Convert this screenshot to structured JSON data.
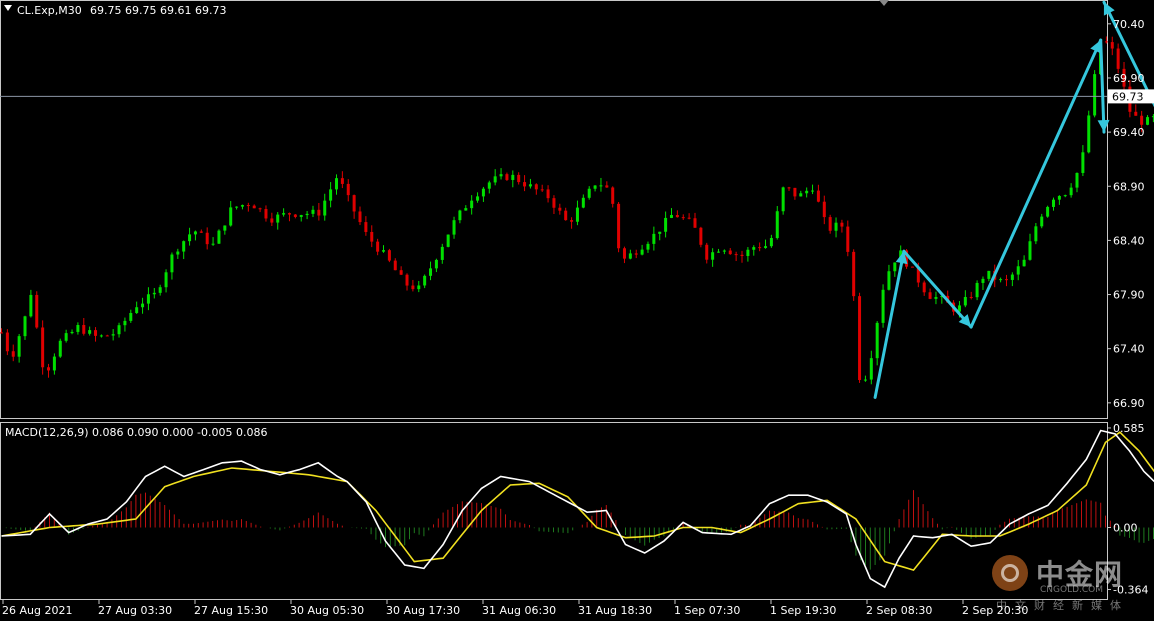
{
  "header": {
    "triangle_icon": "dropdown-triangle-icon"
  },
  "chart_data": [
    {
      "type": "candlestick",
      "title": "CL.Exp,M30",
      "ohlc_label": "69.75 69.75 69.61 69.73",
      "current_price": 69.73,
      "current_price_label": "69.73",
      "ylim": [
        66.76,
        70.62
      ],
      "y_ticks": [
        "70.40",
        "69.90",
        "69.40",
        "68.90",
        "68.40",
        "67.90",
        "67.40",
        "66.90"
      ],
      "x_labels": [
        "26 Aug 2021",
        "27 Aug 03:30",
        "27 Aug 15:30",
        "30 Aug 05:30",
        "30 Aug 17:30",
        "31 Aug 06:30",
        "31 Aug 18:30",
        "1 Sep 07:30",
        "1 Sep 19:30",
        "2 Sep 08:30",
        "2 Sep 20:30"
      ],
      "candle_count": 206,
      "up_color": "#00e000",
      "down_color": "#e00000",
      "price_path": [
        [
          0,
          67.55
        ],
        [
          2,
          67.3
        ],
        [
          5,
          67.7
        ],
        [
          6,
          67.95
        ],
        [
          9,
          67.15
        ],
        [
          12,
          67.45
        ],
        [
          16,
          67.6
        ],
        [
          20,
          67.5
        ],
        [
          24,
          67.55
        ],
        [
          28,
          67.8
        ],
        [
          32,
          67.9
        ],
        [
          36,
          68.3
        ],
        [
          40,
          68.5
        ],
        [
          44,
          68.35
        ],
        [
          48,
          68.7
        ],
        [
          52,
          68.75
        ],
        [
          56,
          68.6
        ],
        [
          60,
          68.65
        ],
        [
          66,
          68.65
        ],
        [
          70,
          69.0
        ],
        [
          72,
          68.8
        ],
        [
          76,
          68.45
        ],
        [
          80,
          68.25
        ],
        [
          84,
          68.0
        ],
        [
          87,
          67.95
        ],
        [
          90,
          68.2
        ],
        [
          94,
          68.55
        ],
        [
          98,
          68.8
        ],
        [
          102,
          68.95
        ],
        [
          106,
          69.0
        ],
        [
          110,
          68.9
        ],
        [
          114,
          68.8
        ],
        [
          118,
          68.55
        ],
        [
          121,
          68.75
        ],
        [
          124,
          68.95
        ],
        [
          127,
          68.85
        ],
        [
          129,
          68.2
        ],
        [
          132,
          68.3
        ],
        [
          136,
          68.45
        ],
        [
          140,
          68.65
        ],
        [
          144,
          68.55
        ],
        [
          147,
          68.25
        ],
        [
          150,
          68.35
        ],
        [
          154,
          68.25
        ],
        [
          157,
          68.35
        ],
        [
          160,
          68.35
        ],
        [
          163,
          68.9
        ],
        [
          166,
          68.8
        ],
        [
          169,
          68.9
        ],
        [
          172,
          68.5
        ],
        [
          175,
          68.55
        ],
        [
          177,
          68.2
        ],
        [
          179,
          67.0
        ],
        [
          181,
          67.3
        ],
        [
          184,
          68.05
        ],
        [
          187,
          68.3
        ],
        [
          190,
          68.1
        ],
        [
          193,
          67.9
        ],
        [
          196,
          67.85
        ],
        [
          199,
          67.75
        ],
        [
          202,
          67.9
        ],
        [
          205,
          68.1
        ],
        [
          209,
          68.0
        ],
        [
          213,
          68.2
        ],
        [
          216,
          68.6
        ],
        [
          219,
          68.8
        ],
        [
          222,
          68.85
        ],
        [
          225,
          69.1
        ],
        [
          227,
          69.7
        ],
        [
          229,
          70.25
        ],
        [
          231,
          70.2
        ],
        [
          233,
          69.95
        ],
        [
          235,
          69.6
        ],
        [
          237,
          69.5
        ],
        [
          239,
          69.5
        ],
        [
          241,
          69.55
        ],
        [
          243,
          69.55
        ],
        [
          245,
          69.75
        ],
        [
          247,
          69.7
        ],
        [
          249,
          69.65
        ],
        [
          251,
          69.73
        ]
      ],
      "trend_arrows": [
        [
          {
            "i": 182,
            "p": 66.95
          },
          {
            "i": 188,
            "p": 68.3
          }
        ],
        [
          {
            "i": 188,
            "p": 68.3
          },
          {
            "i": 202,
            "p": 67.6
          }
        ],
        [
          {
            "i": 202,
            "p": 67.6
          },
          {
            "i": 229,
            "p": 70.25
          }
        ],
        [
          {
            "i": 229,
            "p": 70.25
          },
          {
            "i": 243,
            "p": 69.4
          }
        ],
        [
          {
            "i": 243,
            "p": 69.4
          },
          {
            "i": 263,
            "p": 70.6
          }
        ]
      ],
      "trend_color": "#35c7dd"
    },
    {
      "type": "macd",
      "title": "MACD(12,26,9) 0.086 0.090 0.000 -0.005 0.086",
      "ylim": [
        -0.42,
        0.62
      ],
      "y_ticks": [
        "0.585",
        "0.00",
        "-0.364"
      ],
      "macd_color": "#ffffff",
      "signal_color": "#f0e020",
      "hist_up_color": "#c01010",
      "hist_down_color": "#1e7a1e",
      "macd_line": [
        [
          0,
          -0.05
        ],
        [
          6,
          -0.04
        ],
        [
          10,
          0.08
        ],
        [
          14,
          -0.03
        ],
        [
          18,
          0.02
        ],
        [
          22,
          0.05
        ],
        [
          26,
          0.15
        ],
        [
          30,
          0.3
        ],
        [
          34,
          0.36
        ],
        [
          38,
          0.3
        ],
        [
          42,
          0.34
        ],
        [
          46,
          0.38
        ],
        [
          50,
          0.39
        ],
        [
          54,
          0.34
        ],
        [
          58,
          0.31
        ],
        [
          62,
          0.34
        ],
        [
          66,
          0.38
        ],
        [
          70,
          0.3
        ],
        [
          72,
          0.27
        ],
        [
          76,
          0.15
        ],
        [
          80,
          -0.08
        ],
        [
          84,
          -0.22
        ],
        [
          88,
          -0.24
        ],
        [
          92,
          -0.1
        ],
        [
          96,
          0.1
        ],
        [
          100,
          0.23
        ],
        [
          104,
          0.3
        ],
        [
          110,
          0.27
        ],
        [
          116,
          0.18
        ],
        [
          122,
          0.09
        ],
        [
          126,
          0.1
        ],
        [
          130,
          -0.1
        ],
        [
          134,
          -0.15
        ],
        [
          138,
          -0.08
        ],
        [
          142,
          0.03
        ],
        [
          146,
          -0.03
        ],
        [
          152,
          -0.04
        ],
        [
          156,
          0.01
        ],
        [
          160,
          0.14
        ],
        [
          164,
          0.19
        ],
        [
          168,
          0.19
        ],
        [
          172,
          0.15
        ],
        [
          176,
          0.08
        ],
        [
          178,
          -0.1
        ],
        [
          181,
          -0.3
        ],
        [
          184,
          -0.35
        ],
        [
          187,
          -0.18
        ],
        [
          190,
          -0.05
        ],
        [
          194,
          -0.06
        ],
        [
          198,
          -0.04
        ],
        [
          202,
          -0.11
        ],
        [
          206,
          -0.09
        ],
        [
          210,
          0.02
        ],
        [
          214,
          0.08
        ],
        [
          218,
          0.13
        ],
        [
          222,
          0.26
        ],
        [
          226,
          0.4
        ],
        [
          229,
          0.57
        ],
        [
          232,
          0.55
        ],
        [
          235,
          0.45
        ],
        [
          238,
          0.33
        ],
        [
          242,
          0.22
        ],
        [
          246,
          0.17
        ],
        [
          250,
          0.16
        ],
        [
          251,
          0.15
        ]
      ],
      "signal_line": [
        [
          0,
          -0.05
        ],
        [
          10,
          0.0
        ],
        [
          20,
          0.02
        ],
        [
          28,
          0.05
        ],
        [
          34,
          0.24
        ],
        [
          40,
          0.3
        ],
        [
          48,
          0.35
        ],
        [
          56,
          0.33
        ],
        [
          64,
          0.31
        ],
        [
          72,
          0.27
        ],
        [
          78,
          0.1
        ],
        [
          86,
          -0.2
        ],
        [
          92,
          -0.18
        ],
        [
          100,
          0.1
        ],
        [
          106,
          0.25
        ],
        [
          112,
          0.26
        ],
        [
          118,
          0.18
        ],
        [
          124,
          0.0
        ],
        [
          130,
          -0.06
        ],
        [
          136,
          -0.05
        ],
        [
          142,
          0.0
        ],
        [
          148,
          0.0
        ],
        [
          154,
          -0.03
        ],
        [
          160,
          0.05
        ],
        [
          166,
          0.14
        ],
        [
          172,
          0.16
        ],
        [
          178,
          0.05
        ],
        [
          184,
          -0.2
        ],
        [
          190,
          -0.25
        ],
        [
          196,
          -0.04
        ],
        [
          202,
          -0.05
        ],
        [
          208,
          -0.05
        ],
        [
          214,
          0.02
        ],
        [
          220,
          0.1
        ],
        [
          226,
          0.25
        ],
        [
          230,
          0.5
        ],
        [
          233,
          0.56
        ],
        [
          237,
          0.45
        ],
        [
          242,
          0.26
        ],
        [
          248,
          0.16
        ],
        [
          251,
          0.17
        ]
      ]
    }
  ],
  "watermark": {
    "brand": "中金网",
    "domain": "CNGOLD.COM",
    "sub": "中文财经新媒体"
  }
}
